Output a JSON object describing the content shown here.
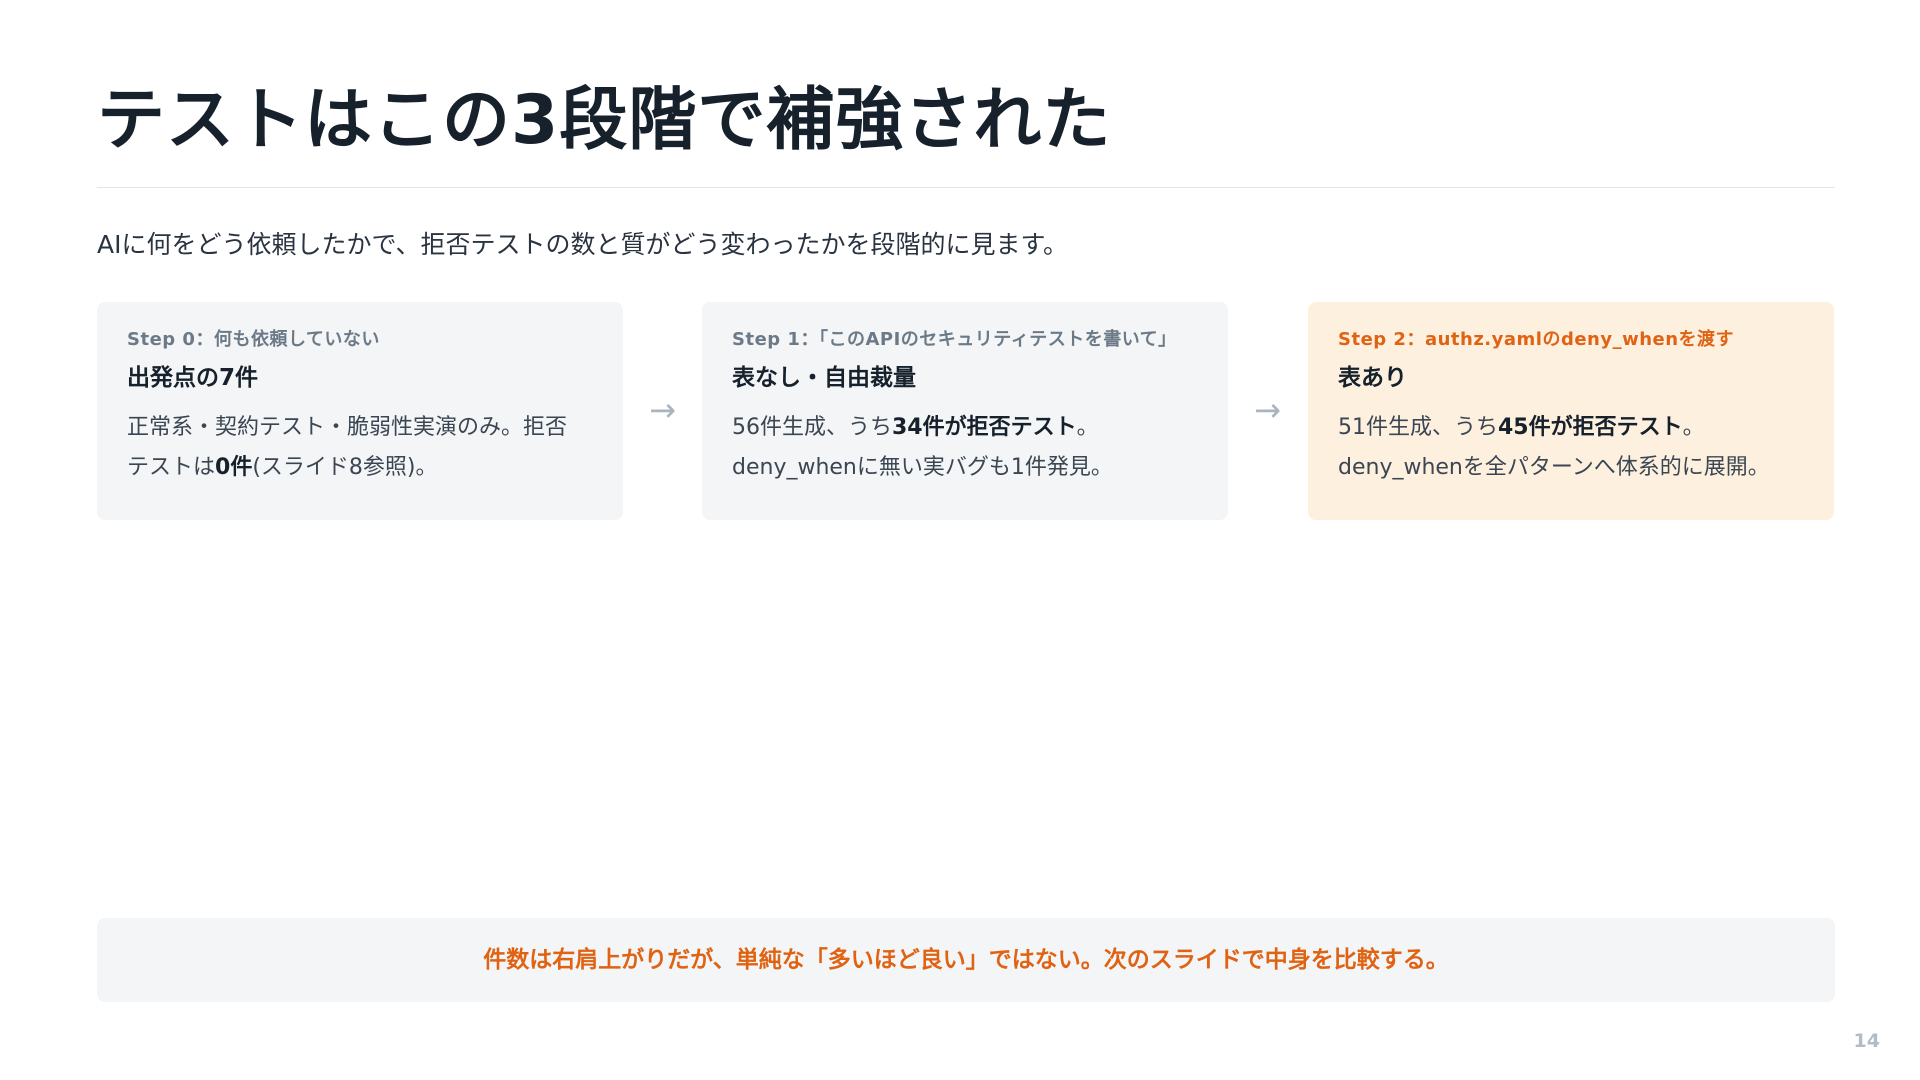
{
  "slide": {
    "title": "テストはこの3段階で補強された",
    "lead": "AIに何をどう依頼したかで、拒否テストの数と質がどう変わったかを段階的に見ます。",
    "page_number": "14"
  },
  "steps": [
    {
      "label": "Step 0：何も依頼していない",
      "heading": "出発点の7件",
      "line1_pre": "正常系・契約テスト・脆弱性実演のみ。拒否",
      "line1_bold": "",
      "line2_pre": "テストは",
      "line2_bold": "0件",
      "line2_post": "(スライド8参照)。"
    },
    {
      "label": "Step 1：「このAPIのセキュリティテストを書いて」",
      "heading": "表なし・自由裁量",
      "line1_pre": "56件生成、うち",
      "line1_bold": "34件が拒否テスト",
      "line1_post": "。",
      "line2_pre": "deny_whenに無い実バグも1件発見。",
      "line2_bold": "",
      "line2_post": ""
    },
    {
      "label": "Step 2：authz.yamlのdeny_whenを渡す",
      "heading": "表あり",
      "line1_pre": "51件生成、うち",
      "line1_bold": "45件が拒否テスト",
      "line1_post": "。",
      "line2_pre": "deny_whenを全パターンへ体系的に展開。",
      "line2_bold": "",
      "line2_post": ""
    }
  ],
  "arrow_glyph": "→",
  "callout": "件数は右肩上がりだが、単純な「多いほど良い」ではない。次のスライドで中身を比較する。",
  "colors": {
    "accent": "#e06313",
    "card_background": "#f3f5f7",
    "highlight_card_background": "#fdf0df",
    "title": "#17212b"
  }
}
